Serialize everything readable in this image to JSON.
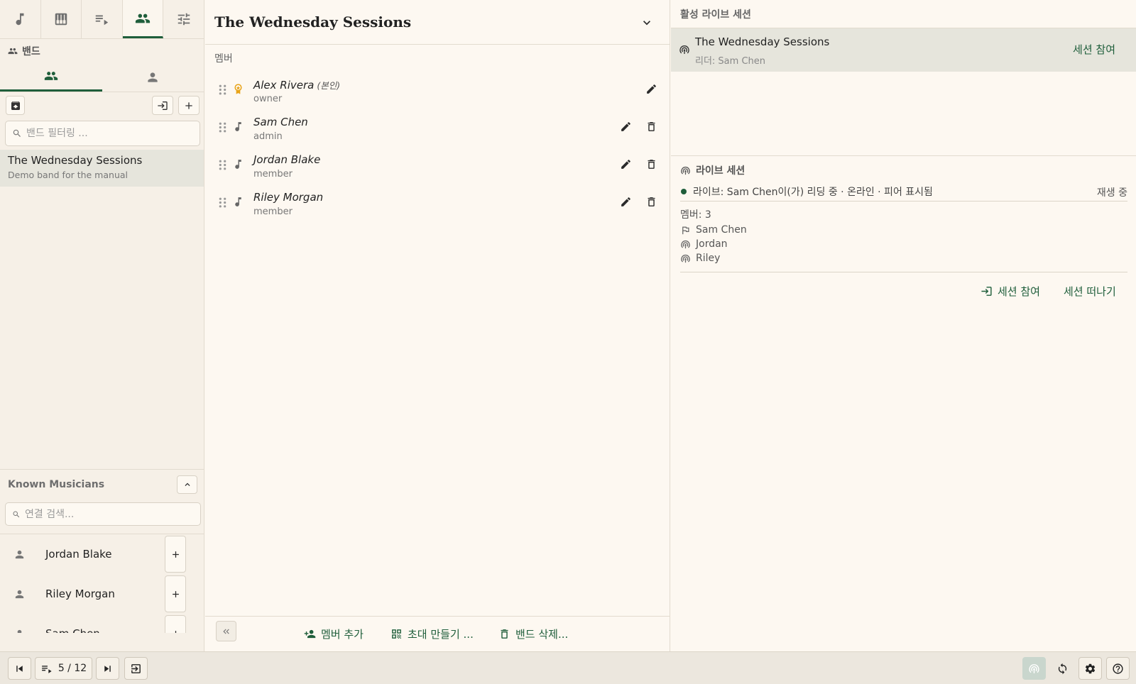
{
  "nav_tabs": [
    {
      "icon": "music-note-icon"
    },
    {
      "icon": "piano-icon"
    },
    {
      "icon": "playlist-icon"
    },
    {
      "icon": "people-icon",
      "active": true
    },
    {
      "icon": "tune-icon"
    }
  ],
  "left": {
    "section_title": "밴드",
    "band_search_placeholder": "밴드 필터링 ...",
    "bands": [
      {
        "name": "The Wednesday Sessions",
        "description": "Demo band for the manual"
      }
    ],
    "known_title": "Known Musicians",
    "known_search_placeholder": "연결 검색...",
    "known_musicians": [
      {
        "name": "Jordan Blake"
      },
      {
        "name": "Riley Morgan"
      },
      {
        "name": "Sam Chen"
      }
    ]
  },
  "middle": {
    "title": "The Wednesday Sessions",
    "members_label": "멤버",
    "members": [
      {
        "name": "Alex Rivera",
        "self_tag": "(본인)",
        "role": "owner"
      },
      {
        "name": "Sam Chen",
        "role": "admin"
      },
      {
        "name": "Jordan Blake",
        "role": "member"
      },
      {
        "name": "Riley Morgan",
        "role": "member"
      }
    ],
    "footer": {
      "add_member": "멤버 추가",
      "make_invite": "초대 만들기 ...",
      "delete_band": "밴드 삭제..."
    }
  },
  "right": {
    "active_sessions_label": "활성 라이브 세션",
    "session": {
      "name": "The Wednesday Sessions",
      "leader": "리더: Sam Chen",
      "join": "세션 참여"
    },
    "live": {
      "title": "라이브 세션",
      "status": "라이브: Sam Chen이(가) 리딩 중 · 온라인 · 피어 표시됨",
      "playing": "재생 중",
      "member_count": "멤버: 3",
      "peers": [
        {
          "name": "Sam Chen",
          "icon": "flag-icon"
        },
        {
          "name": "Jordan",
          "icon": "broadcast-icon"
        },
        {
          "name": "Riley",
          "icon": "broadcast-icon"
        }
      ],
      "join_session": "세션 참여",
      "leave_session": "세션 떠나기"
    }
  },
  "bottom": {
    "page_indicator": "5 / 12"
  },
  "colors": {
    "accent": "#1f5e3b",
    "owner": "#e8a318",
    "background": "#fdf8f1"
  }
}
